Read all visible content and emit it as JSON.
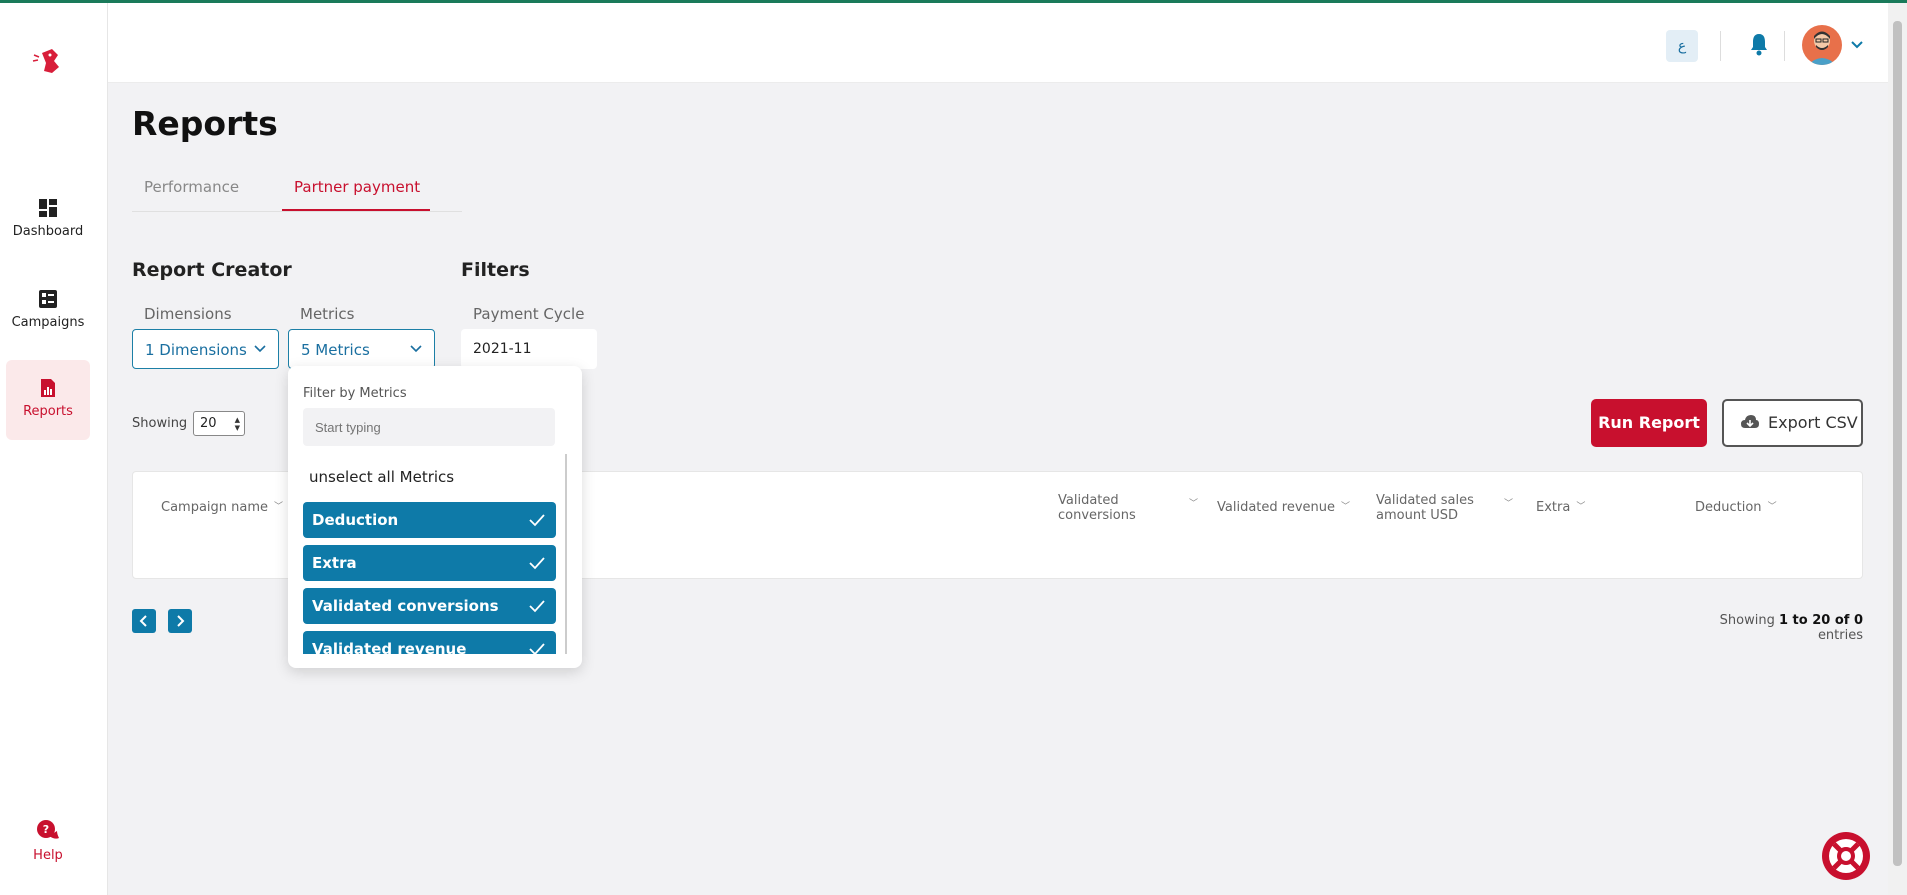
{
  "sidebar": {
    "items": [
      {
        "label": "Dashboard",
        "icon": "dashboard-icon"
      },
      {
        "label": "Campaigns",
        "icon": "campaigns-icon"
      },
      {
        "label": "Reports",
        "icon": "reports-icon",
        "active": true
      }
    ],
    "help_label": "Help"
  },
  "header": {
    "lang_label": "ع"
  },
  "page": {
    "title": "Reports",
    "tabs": [
      {
        "label": "Performance"
      },
      {
        "label": "Partner payment",
        "active": true
      }
    ]
  },
  "report_creator": {
    "title": "Report Creator",
    "dimensions_label": "Dimensions",
    "dimensions_value": "1 Dimensions",
    "metrics_label": "Metrics",
    "metrics_value": "5 Metrics"
  },
  "filters": {
    "title": "Filters",
    "payment_cycle_label": "Payment Cycle",
    "payment_cycle_value": "2021-11"
  },
  "controls": {
    "showing_label": "Showing",
    "page_size": "20",
    "run_label": "Run Report",
    "export_label": "Export CSV"
  },
  "table": {
    "columns": [
      "Campaign name",
      "Validated conversions",
      "Validated revenue",
      "Validated sales amount USD",
      "Extra",
      "Deduction"
    ]
  },
  "pagination": {
    "entries_prefix": "Showing",
    "entries_range": "1 to 20 of 0",
    "entries_suffix": "entries"
  },
  "metrics_dropdown": {
    "filter_label": "Filter by Metrics",
    "search_placeholder": "Start typing",
    "unselect_label": "unselect all Metrics",
    "options": [
      "Deduction",
      "Extra",
      "Validated conversions",
      "Validated revenue"
    ]
  },
  "colors": {
    "brand_red": "#c8102e",
    "accent_blue": "#0e7aa8",
    "top_line": "#1a7a5a"
  }
}
